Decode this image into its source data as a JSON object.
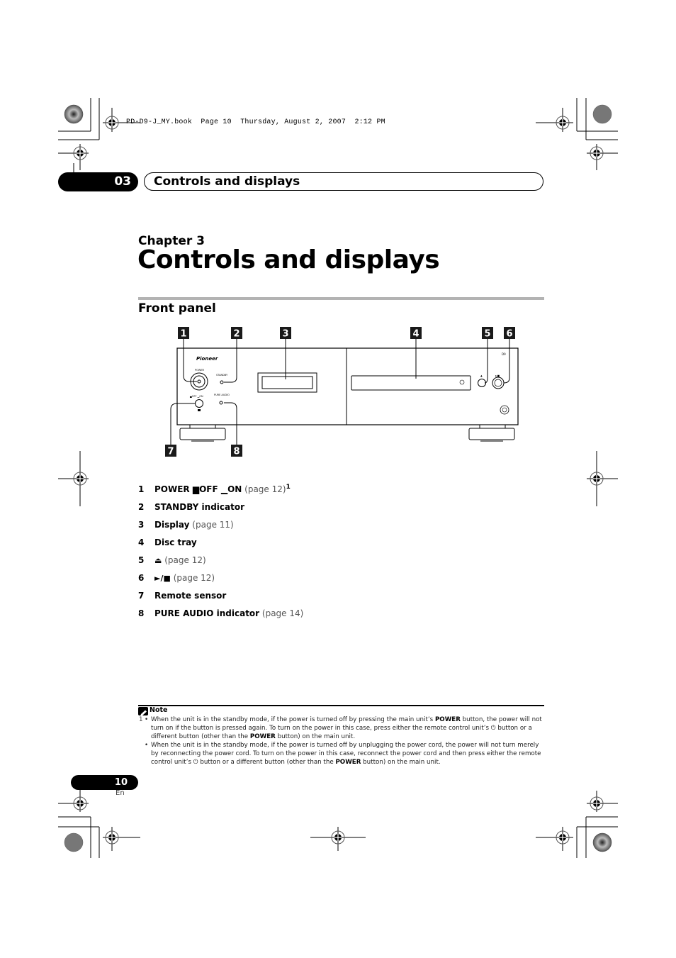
{
  "print_header": {
    "book_line": "PD-D9-J_MY.book  Page 10  Thursday, August 2, 2007  2:12 PM"
  },
  "header": {
    "chapter_number": "03",
    "chapter_title": "Controls and displays"
  },
  "chapter": {
    "label": "Chapter 3",
    "title": "Controls and displays"
  },
  "section": {
    "title": "Front panel"
  },
  "figure": {
    "callouts": [
      "1",
      "2",
      "3",
      "4",
      "5",
      "6",
      "7",
      "8"
    ],
    "device_labels": {
      "brand": "Pioneer",
      "power": "POWER",
      "standby": "STANDBY",
      "off_on": "▄OFF ▁ON",
      "pure_audio": "PURE AUDIO",
      "model": "D9",
      "eject_symbol": "▲",
      "play_stop_symbol": "►■"
    }
  },
  "items": [
    {
      "num": "1",
      "bold": "POWER ▆OFF ▁ON",
      "ref": " (page 12)",
      "sup": "1"
    },
    {
      "num": "2",
      "bold": "STANDBY indicator",
      "ref": "",
      "sup": ""
    },
    {
      "num": "3",
      "bold": "Display",
      "ref": " (page 11)",
      "sup": ""
    },
    {
      "num": "4",
      "bold": "Disc tray",
      "ref": "",
      "sup": ""
    },
    {
      "num": "5",
      "bold": "⏏",
      "ref": " (page 12)",
      "sup": ""
    },
    {
      "num": "6",
      "bold": "►/■",
      "ref": " (page 12)",
      "sup": ""
    },
    {
      "num": "7",
      "bold": "Remote sensor",
      "ref": "",
      "sup": ""
    },
    {
      "num": "8",
      "bold": "PURE AUDIO indicator",
      "ref": " (page 14)",
      "sup": ""
    }
  ],
  "note": {
    "label": "Note",
    "footnote_mark": "1",
    "bullets": [
      {
        "t1": "When the unit is in the standby mode, if the power is turned off by pressing the main unit’s ",
        "b1": "POWER",
        "t2": " button, the power will not turn on if the button is pressed again. To turn on the power in this case, press either the remote control unit’s ⏻ button or a different button (other than the ",
        "b2": "POWER",
        "t3": " button) on the main unit."
      },
      {
        "t1": "When the unit is in the standby mode, if the power is turned off by unplugging the power cord, the power will not turn merely by reconnecting the power cord. To turn on the power in this case, reconnect the power cord and then press either the remote control unit’s ⏻ button or a different button (other than the ",
        "b1": "POWER",
        "t2": " button) on the main unit.",
        "b2": "",
        "t3": ""
      }
    ]
  },
  "footer": {
    "page_number": "10",
    "language": "En"
  }
}
